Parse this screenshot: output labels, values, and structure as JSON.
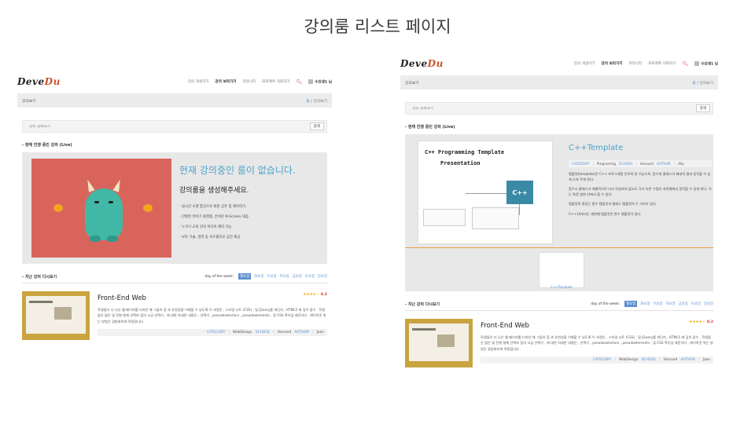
{
  "slide_title": "강의룸 리스트 페이지",
  "site": {
    "logo_a": "Deve",
    "logo_b": "Du",
    "nav": [
      "강의 개설하기",
      "강의 보러가기",
      "커뮤니티",
      "프로젝트 의뢰하기"
    ],
    "user": "수강생1 님"
  },
  "crumb": {
    "title": "강의보기",
    "home": "홈",
    "sep": "/",
    "current": "강의보기"
  },
  "search": {
    "placeholder": "강의 검색하기",
    "button": "검색"
  },
  "live_section": "- 현재 진행 중인 강의 (Live)",
  "live_empty": {
    "title": "현재 강의중인 룸이 없습니다.",
    "subtitle": "강의룸을 생성해주세요.",
    "bullets": [
      "- 실시간 소켓 통신으로 화면 공유 및 제어하기.",
      "- 간편한 마이크 플랫폼, 손쉬운 N-Screen 대응.",
      "- 누구나 교육 강의 미디어 제작 가능.",
      "- 보유 기술, 경력 등 포트폴리오 공간 제공."
    ]
  },
  "past_section": "- 지난 강의 다시보기",
  "days": {
    "label": "day of the week:",
    "items": [
      "월요일",
      "화요일",
      "수요일",
      "목요일",
      "금요일",
      "토요일",
      "일요일"
    ],
    "selected": 0
  },
  "course": {
    "title": "Front-End Web",
    "stars": "★★★★☆",
    "score": "8.2",
    "desc": "학생들이 더 나은 웹 페이지를 디자인 해 그들의 힘 과 유연성을 이해할 수 있도록 이 과정은 , 스타일 시트 (CSS) , 및 jQuery를 개단지 , HTML5 에 깊이 잠수 . 학생들은 많은 및 전형 형체 선택자 집의 고급 선택기 , 에 대한 자세한 내용은 , 선택기 , pseudoselectors , pseudoelements , 및 CSS 쪽이섬 레운더다 . 레이아웃 위는 방법은 광범위하게 적용합니다 .",
    "meta": [
      {
        "k": "CATEGORY",
        "v": "WebDesign"
      },
      {
        "k": "SCHOOL",
        "v": "Harvard"
      },
      {
        "k": "AUTHOR",
        "v": "Joan"
      }
    ]
  },
  "cpp": {
    "img_line1": "C++ Programming Template",
    "img_line2": "Presentation",
    "img_cube": "C++",
    "title": "C++Template",
    "meta": [
      {
        "k": "CATEGORY",
        "v": "Programing"
      },
      {
        "k": "SCHOOL",
        "v": "Harvard"
      },
      {
        "k": "AUTHOR",
        "v": "Ally"
      }
    ],
    "paras": [
      "템플릿(template)은 C++ 프로그래밍 언어의 한 기능으로, 함수와 클래스가 제네릭 형과 동작할 수 있게 도와 주게 된다.",
      "함수나 클래스가 개별적으로 다시 작성하지 않고도 각기 다른 수많은 자료형에서 동작할 수 있게 한다. 이는 특정 범위 안에서 볼 수 있다.",
      "템플릿의 종류는 함수 템플릿과 클래스 템플릿의 두 가지가 있다.",
      "C++14부터는 세번째 템플릿인 변수 템플릿이 있다."
    ],
    "mini_caption": "C++Template"
  },
  "colors": {
    "accent": "#4aa3c9",
    "link": "#5a8fd0",
    "brand": "#c9542d",
    "live_bg": "#d9645c",
    "monster": "#41b8a5"
  }
}
